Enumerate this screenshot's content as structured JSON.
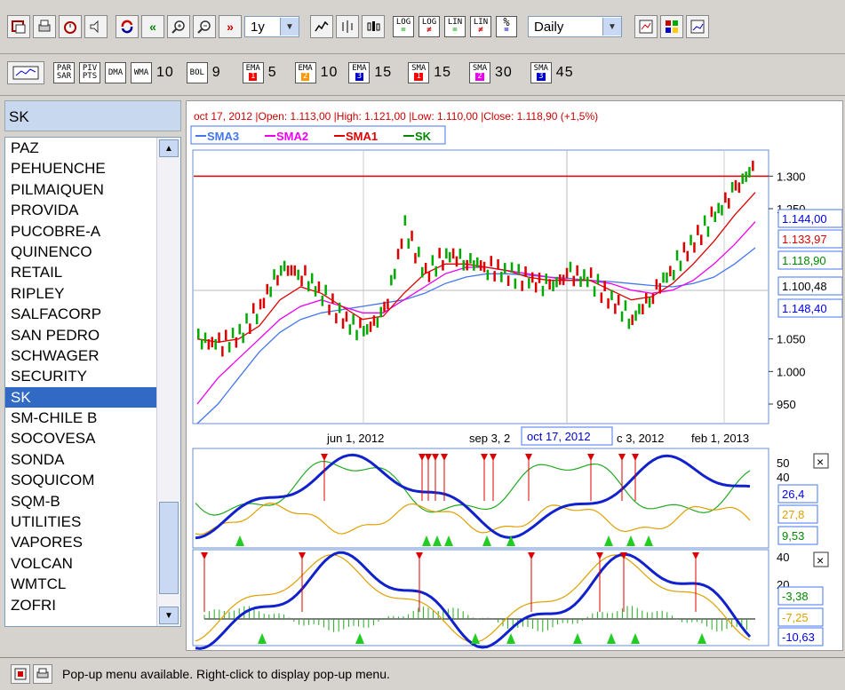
{
  "toolbar1": {
    "icons": [
      "new-window-icon",
      "print-icon",
      "timer-icon",
      "sound-icon",
      "refresh-icon",
      "rewind-icon",
      "zoom-in-icon",
      "zoom-out-icon",
      "fast-forward-icon"
    ],
    "period": "1y",
    "type_icons": [
      "line-chart-icon",
      "bar-chart-icon",
      "candlestick-icon"
    ],
    "scale_buttons": [
      [
        "LOG",
        "="
      ],
      [
        "LOG",
        "≠"
      ],
      [
        "LIN",
        "="
      ],
      [
        "LIN",
        "≠"
      ],
      [
        "%",
        "="
      ]
    ],
    "interval": "Daily",
    "view_icons": [
      "indicator-window-icon",
      "color-palette-icon",
      "compare-chart-icon"
    ]
  },
  "toolbar2": {
    "btn_a": [
      "PAR",
      "SAR"
    ],
    "btn_b": [
      "PIV",
      "PTS"
    ],
    "dma": "DMA",
    "wma": "WMA",
    "wma_val": "10",
    "bol": "BOL",
    "bol_val": "9",
    "ema": [
      {
        "n": "1",
        "v": "5"
      },
      {
        "n": "2",
        "v": "10"
      },
      {
        "n": "3",
        "v": "15"
      }
    ],
    "sma": [
      {
        "n": "1",
        "v": "15"
      },
      {
        "n": "2",
        "v": "30"
      },
      {
        "n": "3",
        "v": "45"
      }
    ],
    "ema_label": "EMA",
    "sma_label": "SMA"
  },
  "symbol": "SK",
  "list": [
    "PAZ",
    "PEHUENCHE",
    "PILMAIQUEN",
    "PROVIDA",
    "PUCOBRE-A",
    "QUINENCO",
    "RETAIL",
    "RIPLEY",
    "SALFACORP",
    "SAN PEDRO",
    "SCHWAGER",
    "SECURITY",
    "SK",
    "SM-CHILE B",
    "SOCOVESA",
    "SONDA",
    "SOQUICOM",
    "SQM-B",
    "UTILITIES",
    "VAPORES",
    "VOLCAN",
    "WMTCL",
    "ZOFRI"
  ],
  "selected": "SK",
  "chart": {
    "info": "oct 17, 2012 |Open: 1.113,00 |High: 1.121,00 |Low: 1.110,00 |Close: 1.118,90 (+1,5%)",
    "legend": [
      {
        "name": "SMA3",
        "color": "#4477ee"
      },
      {
        "name": "SMA2",
        "color": "#ee00ee"
      },
      {
        "name": "SMA1",
        "color": "#dd0000"
      },
      {
        "name": "SK",
        "color": "#008800"
      }
    ],
    "price_ticks": [
      "1.300",
      "1.250",
      "1.050",
      "1.000",
      "950"
    ],
    "price_labels": [
      {
        "text": "1.144,00",
        "color": "#0000ee"
      },
      {
        "text": "1.133,97",
        "color": "#dd0000"
      },
      {
        "text": "1.118,90",
        "color": "#008800"
      },
      {
        "text": "1.100,48",
        "color": "#000000"
      },
      {
        "text": "1.148,40",
        "color": "#0000ee"
      }
    ],
    "date_labels": [
      "jun 1, 2012",
      "sep 3, 2",
      "c 3, 2012",
      "feb 1, 2013"
    ],
    "cursor_date": "oct 17, 2012",
    "osc1_ticks": [
      "50",
      "40"
    ],
    "osc1_labels": [
      {
        "text": "26,4",
        "color": "#0000ee"
      },
      {
        "text": "27,8",
        "color": "#e0a000"
      },
      {
        "text": "9,53",
        "color": "#008800"
      }
    ],
    "osc2_ticks": [
      "40",
      "20"
    ],
    "osc2_labels": [
      {
        "text": "-3,38",
        "color": "#008800"
      },
      {
        "text": "-7,25",
        "color": "#e0a000"
      },
      {
        "text": "-10,63",
        "color": "#0000ee"
      }
    ],
    "close_icon": "×"
  },
  "chart_data": {
    "type": "line",
    "title": "",
    "symbol": "SK",
    "x_range": [
      "2012-03",
      "2013-02"
    ],
    "ylim": [
      920,
      1340
    ],
    "series": [
      {
        "name": "SK",
        "values": [
          1050,
          1040,
          1055,
          1100,
          1160,
          1150,
          1120,
          1080,
          1060,
          1090,
          1220,
          1150,
          1180,
          1170,
          1160,
          1150,
          1140,
          1130,
          1150,
          1140,
          1110,
          1080,
          1120,
          1160,
          1200,
          1240,
          1280,
          1320
        ]
      },
      {
        "name": "SMA1",
        "values": [
          1050,
          1045,
          1050,
          1070,
          1110,
          1130,
          1120,
          1100,
          1080,
          1085,
          1120,
          1150,
          1165,
          1165,
          1160,
          1155,
          1145,
          1140,
          1140,
          1140,
          1125,
          1110,
          1115,
          1135,
          1165,
          1200,
          1240,
          1275
        ]
      },
      {
        "name": "SMA2",
        "values": [
          950,
          990,
          1020,
          1050,
          1080,
          1100,
          1110,
          1100,
          1090,
          1090,
          1110,
          1130,
          1150,
          1160,
          1160,
          1155,
          1150,
          1145,
          1140,
          1140,
          1135,
          1125,
          1120,
          1125,
          1140,
          1165,
          1195,
          1230
        ]
      },
      {
        "name": "SMA3",
        "values": [
          920,
          950,
          990,
          1030,
          1060,
          1080,
          1090,
          1095,
          1100,
          1105,
          1110,
          1120,
          1135,
          1145,
          1150,
          1150,
          1148,
          1145,
          1143,
          1140,
          1138,
          1135,
          1132,
          1130,
          1135,
          1145,
          1165,
          1190
        ]
      }
    ],
    "resistance": 1300
  }
}
